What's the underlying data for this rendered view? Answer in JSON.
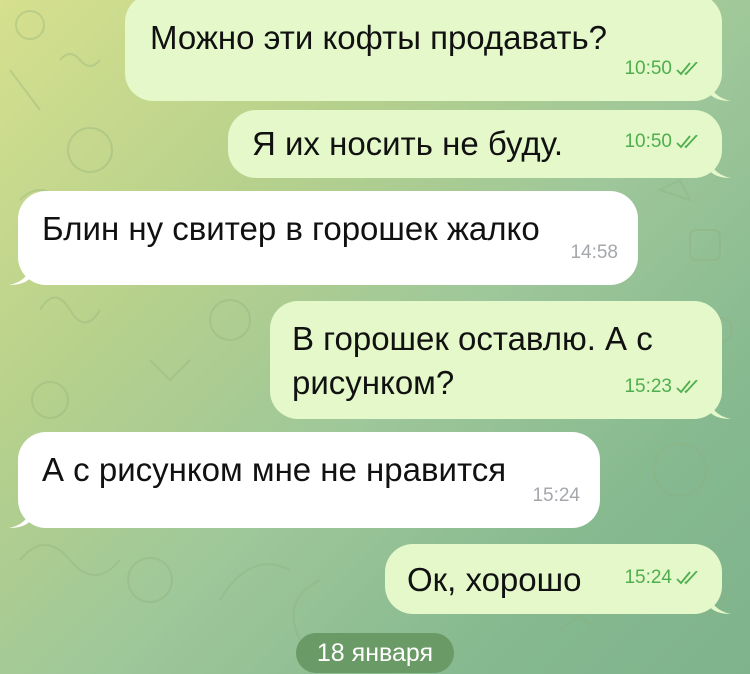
{
  "chat": {
    "messages": [
      {
        "direction": "outgoing",
        "text": "Можно эти кофты продавать?",
        "time": "10:50",
        "status": "read"
      },
      {
        "direction": "outgoing",
        "text": "Я их носить не буду.",
        "time": "10:50",
        "status": "read"
      },
      {
        "direction": "incoming",
        "text": "Блин ну свитер в горошек жалко",
        "time": "14:58"
      },
      {
        "direction": "outgoing",
        "text": "В горошек оставлю. А с рисунком?",
        "time": "15:23",
        "status": "read"
      },
      {
        "direction": "incoming",
        "text": "А с рисунком мне не нравится",
        "time": "15:24"
      },
      {
        "direction": "outgoing",
        "text": "Ок, хорошо",
        "time": "15:24",
        "status": "read"
      }
    ],
    "date_separator": "18 января"
  },
  "colors": {
    "outgoing_bubble": "#e4f8c9",
    "incoming_bubble": "#ffffff",
    "read_check": "#4fae4e",
    "date_pill": "#6a9a66"
  },
  "icons": [
    "double-check-icon"
  ]
}
